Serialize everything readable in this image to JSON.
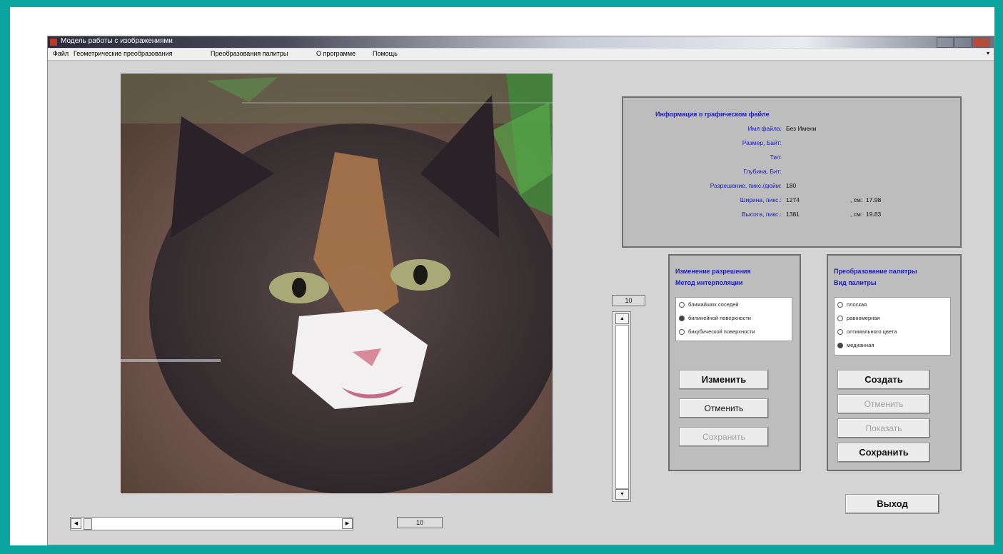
{
  "window": {
    "title": "Модель работы с изображениями"
  },
  "menu": [
    "Файл",
    "Геометрические преобразования",
    "Преобразования палитры",
    "О программе",
    "Помощь"
  ],
  "image": {
    "description_icon": "cat-photo"
  },
  "info_panel": {
    "title": "Информация о графическом файле",
    "rows": [
      {
        "label": "Имя файла:",
        "value": "Без Имени",
        "cm_label": "",
        "cm_value": ""
      },
      {
        "label": "Размер, Байт:",
        "value": "",
        "cm_label": "",
        "cm_value": ""
      },
      {
        "label": "Тип:",
        "value": "",
        "cm_label": "",
        "cm_value": ""
      },
      {
        "label": "Глубина, Бит:",
        "value": "",
        "cm_label": "",
        "cm_value": ""
      },
      {
        "label": "Разрешение, пикс./дюйм:",
        "value": "180",
        "cm_label": "",
        "cm_value": ""
      },
      {
        "label": "Ширина, пикс.:",
        "value": "1274",
        "cm_label": ", см:",
        "cm_value": "17.98"
      },
      {
        "label": "Высота, пикс.:",
        "value": "1381",
        "cm_label": ", см:",
        "cm_value": "19.83"
      }
    ]
  },
  "resize_group": {
    "title_line1": "Изменение разрешения",
    "title_line2": "Метод интерполяции",
    "options": [
      {
        "label": "ближайших соседей",
        "selected": false
      },
      {
        "label": "билинейной поверхности",
        "selected": true
      },
      {
        "label": "бикубической поверхности",
        "selected": false
      }
    ],
    "buttons": {
      "change": "Изменить",
      "cancel": "Отменить",
      "save": "Сохранить"
    }
  },
  "palette_group": {
    "title_line1": "Преобразование палитры",
    "title_line2": "Вид палитры",
    "options": [
      {
        "label": "плоская",
        "selected": false
      },
      {
        "label": "равномерная",
        "selected": false
      },
      {
        "label": "оптимального цвета",
        "selected": false
      },
      {
        "label": "медианная",
        "selected": true
      }
    ],
    "buttons": {
      "create": "Создать",
      "cancel": "Отменить",
      "show": "Показать",
      "save": "Сохранить"
    }
  },
  "vertical_slider": {
    "value": "10"
  },
  "horizontal_slider": {
    "value": "10"
  },
  "exit_button": "Выход",
  "colors": {
    "background": "#0aa59f",
    "window": "#d4d4d4",
    "panel": "#bdbdbd",
    "label_blue": "#1a1ab8"
  }
}
